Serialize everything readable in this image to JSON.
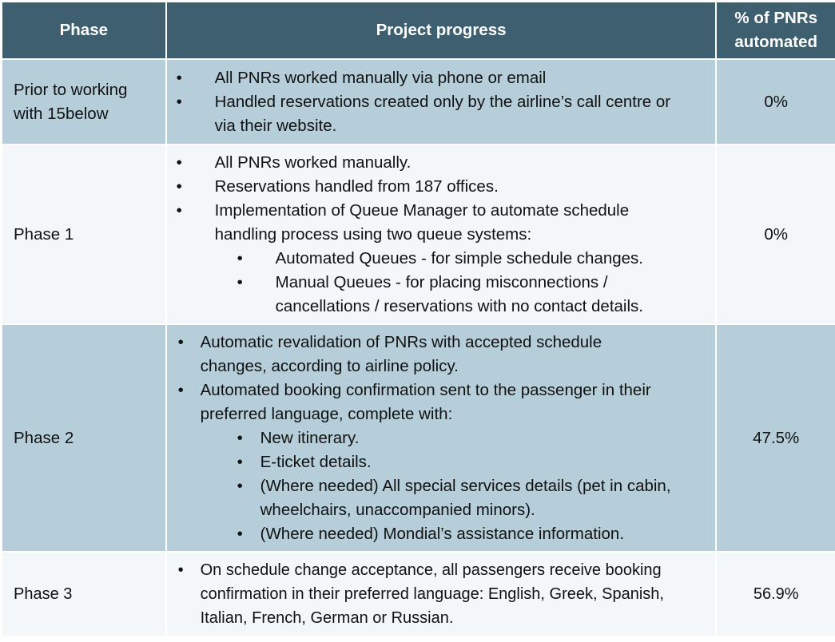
{
  "table": {
    "headers": {
      "phase": "Phase",
      "progress": "Project progress",
      "pct_line1": "% of PNRs",
      "pct_line2": "automated"
    },
    "rows": [
      {
        "phase_line1": "Prior to working",
        "phase_line2": "with 15below",
        "pct": "0%",
        "bullets": [
          {
            "text": "All PNRs worked manually via phone or email"
          },
          {
            "text": "Handled reservations created only by the airline’s call centre or via their website."
          }
        ]
      },
      {
        "phase": "Phase 1",
        "pct": "0%",
        "bullets": [
          {
            "text": "All PNRs worked manually."
          },
          {
            "text": "Reservations handled from 187 offices."
          },
          {
            "text": "Implementation of Queue Manager to automate schedule handling process using two queue systems:",
            "sub": [
              {
                "text": "Automated Queues - for simple schedule changes."
              },
              {
                "text": "Manual Queues - for placing misconnections / cancellations / reservations with no contact details."
              }
            ]
          }
        ]
      },
      {
        "phase": "Phase 2",
        "pct": "47.5%",
        "bullets": [
          {
            "text": "Automatic revalidation of PNRs with accepted schedule changes, according to airline policy."
          },
          {
            "text": "Automated booking confirmation sent to the passenger in their preferred language, complete with:",
            "sub": [
              {
                "text": "New itinerary."
              },
              {
                "text": "E-ticket details."
              },
              {
                "text": "(Where needed) All special services details (pet in cabin, wheelchairs, unaccompanied minors)."
              },
              {
                "text": "(Where needed) Mondial’s assistance information."
              }
            ]
          }
        ]
      },
      {
        "phase": "Phase 3",
        "pct": "56.9%",
        "bullets": [
          {
            "text": "On schedule change acceptance, all passengers receive booking confirmation in their preferred language: English, Greek, Spanish, Italian, French, German or Russian."
          }
        ]
      }
    ],
    "bullet_glyph": "•",
    "colors": {
      "header_bg": "#3e5f70",
      "dark_row_bg": "#b6ced9",
      "light_row_bg": "#f3f7f9"
    }
  }
}
